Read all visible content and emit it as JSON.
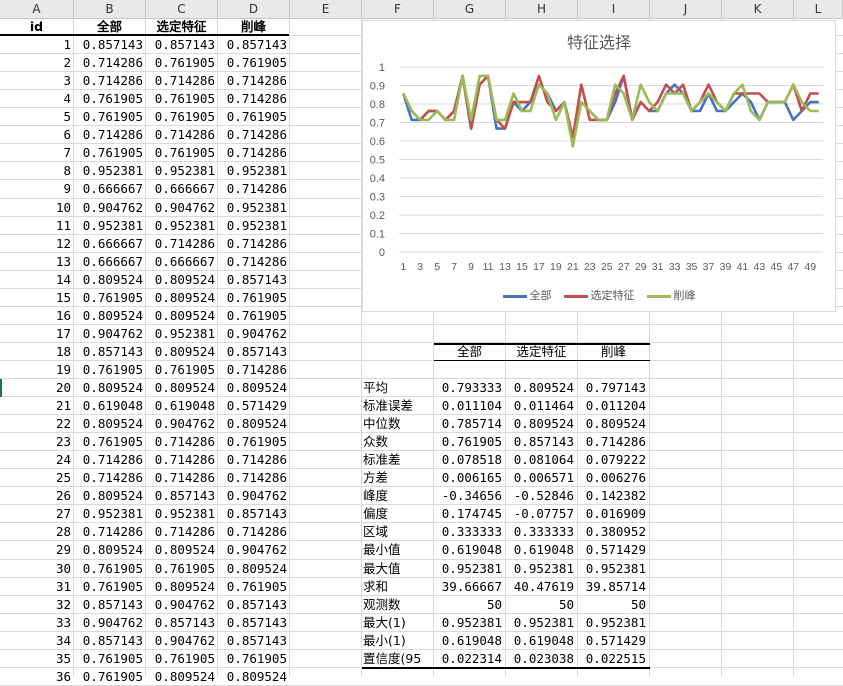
{
  "columns": [
    "A",
    "B",
    "C",
    "D",
    "E",
    "F",
    "G",
    "H",
    "I",
    "J",
    "K",
    "L"
  ],
  "table_headers": [
    "id",
    "全部",
    "选定特征",
    "削峰"
  ],
  "rows": [
    [
      1,
      "0.857143",
      "0.857143",
      "0.857143"
    ],
    [
      2,
      "0.714286",
      "0.761905",
      "0.761905"
    ],
    [
      3,
      "0.714286",
      "0.714286",
      "0.714286"
    ],
    [
      4,
      "0.761905",
      "0.761905",
      "0.714286"
    ],
    [
      5,
      "0.761905",
      "0.761905",
      "0.761905"
    ],
    [
      6,
      "0.714286",
      "0.714286",
      "0.714286"
    ],
    [
      7,
      "0.761905",
      "0.761905",
      "0.714286"
    ],
    [
      8,
      "0.952381",
      "0.952381",
      "0.952381"
    ],
    [
      9,
      "0.666667",
      "0.666667",
      "0.714286"
    ],
    [
      10,
      "0.904762",
      "0.904762",
      "0.952381"
    ],
    [
      11,
      "0.952381",
      "0.952381",
      "0.952381"
    ],
    [
      12,
      "0.666667",
      "0.714286",
      "0.714286"
    ],
    [
      13,
      "0.666667",
      "0.666667",
      "0.714286"
    ],
    [
      14,
      "0.809524",
      "0.809524",
      "0.857143"
    ],
    [
      15,
      "0.761905",
      "0.809524",
      "0.761905"
    ],
    [
      16,
      "0.809524",
      "0.809524",
      "0.761905"
    ],
    [
      17,
      "0.904762",
      "0.952381",
      "0.904762"
    ],
    [
      18,
      "0.857143",
      "0.809524",
      "0.857143"
    ],
    [
      19,
      "0.761905",
      "0.761905",
      "0.714286"
    ],
    [
      20,
      "0.809524",
      "0.809524",
      "0.809524"
    ],
    [
      21,
      "0.619048",
      "0.619048",
      "0.571429"
    ],
    [
      22,
      "0.809524",
      "0.904762",
      "0.809524"
    ],
    [
      23,
      "0.761905",
      "0.714286",
      "0.761905"
    ],
    [
      24,
      "0.714286",
      "0.714286",
      "0.714286"
    ],
    [
      25,
      "0.714286",
      "0.714286",
      "0.714286"
    ],
    [
      26,
      "0.809524",
      "0.857143",
      "0.904762"
    ],
    [
      27,
      "0.952381",
      "0.952381",
      "0.857143"
    ],
    [
      28,
      "0.714286",
      "0.714286",
      "0.714286"
    ],
    [
      29,
      "0.809524",
      "0.809524",
      "0.904762"
    ],
    [
      30,
      "0.761905",
      "0.761905",
      "0.809524"
    ],
    [
      31,
      "0.761905",
      "0.809524",
      "0.761905"
    ],
    [
      32,
      "0.857143",
      "0.904762",
      "0.857143"
    ],
    [
      33,
      "0.904762",
      "0.857143",
      "0.857143"
    ],
    [
      34,
      "0.857143",
      "0.904762",
      "0.857143"
    ],
    [
      35,
      "0.761905",
      "0.761905",
      "0.761905"
    ],
    [
      36,
      "0.761905",
      "0.809524",
      "0.809524"
    ]
  ],
  "stats": {
    "headers": [
      "全部",
      "选定特征",
      "削峰"
    ],
    "rows": [
      [
        "平均",
        "0.793333",
        "0.809524",
        "0.797143"
      ],
      [
        "标准误差",
        "0.011104",
        "0.011464",
        "0.011204"
      ],
      [
        "中位数",
        "0.785714",
        "0.809524",
        "0.809524"
      ],
      [
        "众数",
        "0.761905",
        "0.857143",
        "0.714286"
      ],
      [
        "标准差",
        "0.078518",
        "0.081064",
        "0.079222"
      ],
      [
        "方差",
        "0.006165",
        "0.006571",
        "0.006276"
      ],
      [
        "峰度",
        "-0.34656",
        "-0.52846",
        "0.142382"
      ],
      [
        "偏度",
        "0.174745",
        "-0.07757",
        "0.016909"
      ],
      [
        "区域",
        "0.333333",
        "0.333333",
        "0.380952"
      ],
      [
        "最小值",
        "0.619048",
        "0.619048",
        "0.571429"
      ],
      [
        "最大值",
        "0.952381",
        "0.952381",
        "0.952381"
      ],
      [
        "求和",
        "39.66667",
        "40.47619",
        "39.85714"
      ],
      [
        "观测数",
        "50",
        "50",
        "50"
      ],
      [
        "最大(1)",
        "0.952381",
        "0.952381",
        "0.952381"
      ],
      [
        "最小(1)",
        "0.619048",
        "0.619048",
        "0.571429"
      ],
      [
        "置信度(95",
        "0.022314",
        "0.023038",
        "0.022515"
      ]
    ]
  },
  "chart_data": {
    "type": "line",
    "title": "特征选择",
    "ylim": [
      0,
      1
    ],
    "yticks": [
      "0",
      "0.1",
      "0.2",
      "0.3",
      "0.4",
      "0.5",
      "0.6",
      "0.7",
      "0.8",
      "0.9",
      "1"
    ],
    "xticks": [
      "1",
      "3",
      "5",
      "7",
      "9",
      "11",
      "13",
      "15",
      "17",
      "19",
      "21",
      "23",
      "25",
      "27",
      "29",
      "31",
      "33",
      "35",
      "37",
      "39",
      "41",
      "43",
      "45",
      "47",
      "49"
    ],
    "x": [
      1,
      2,
      3,
      4,
      5,
      6,
      7,
      8,
      9,
      10,
      11,
      12,
      13,
      14,
      15,
      16,
      17,
      18,
      19,
      20,
      21,
      22,
      23,
      24,
      25,
      26,
      27,
      28,
      29,
      30,
      31,
      32,
      33,
      34,
      35,
      36,
      37,
      38,
      39,
      40,
      41,
      42,
      43,
      44,
      45,
      46,
      47,
      48,
      49,
      50
    ],
    "series": [
      {
        "name": "全部",
        "color": "#4472c4",
        "values": [
          0.857,
          0.714,
          0.714,
          0.762,
          0.762,
          0.714,
          0.762,
          0.952,
          0.667,
          0.905,
          0.952,
          0.667,
          0.667,
          0.81,
          0.762,
          0.81,
          0.905,
          0.857,
          0.762,
          0.81,
          0.619,
          0.81,
          0.762,
          0.714,
          0.714,
          0.81,
          0.952,
          0.714,
          0.81,
          0.762,
          0.762,
          0.857,
          0.905,
          0.857,
          0.762,
          0.762,
          0.857,
          0.762,
          0.762,
          0.81,
          0.857,
          0.81,
          0.714,
          0.81,
          0.81,
          0.81,
          0.714,
          0.762,
          0.81,
          0.81
        ]
      },
      {
        "name": "选定特征",
        "color": "#c0504d",
        "values": [
          0.857,
          0.762,
          0.714,
          0.762,
          0.762,
          0.714,
          0.762,
          0.952,
          0.667,
          0.905,
          0.952,
          0.714,
          0.667,
          0.81,
          0.81,
          0.81,
          0.952,
          0.81,
          0.762,
          0.81,
          0.619,
          0.905,
          0.714,
          0.714,
          0.714,
          0.857,
          0.952,
          0.714,
          0.81,
          0.762,
          0.81,
          0.905,
          0.857,
          0.905,
          0.762,
          0.81,
          0.905,
          0.81,
          0.762,
          0.857,
          0.857,
          0.857,
          0.857,
          0.81,
          0.81,
          0.81,
          0.905,
          0.762,
          0.857,
          0.857
        ]
      },
      {
        "name": "削峰",
        "color": "#9bbb59",
        "values": [
          0.857,
          0.762,
          0.714,
          0.714,
          0.762,
          0.714,
          0.714,
          0.952,
          0.714,
          0.952,
          0.952,
          0.714,
          0.714,
          0.857,
          0.762,
          0.762,
          0.905,
          0.857,
          0.714,
          0.81,
          0.571,
          0.81,
          0.762,
          0.714,
          0.714,
          0.905,
          0.857,
          0.714,
          0.905,
          0.81,
          0.762,
          0.857,
          0.857,
          0.857,
          0.762,
          0.81,
          0.857,
          0.81,
          0.762,
          0.857,
          0.905,
          0.762,
          0.714,
          0.81,
          0.81,
          0.81,
          0.905,
          0.81,
          0.762,
          0.762
        ]
      }
    ],
    "legend_position": "bottom"
  }
}
